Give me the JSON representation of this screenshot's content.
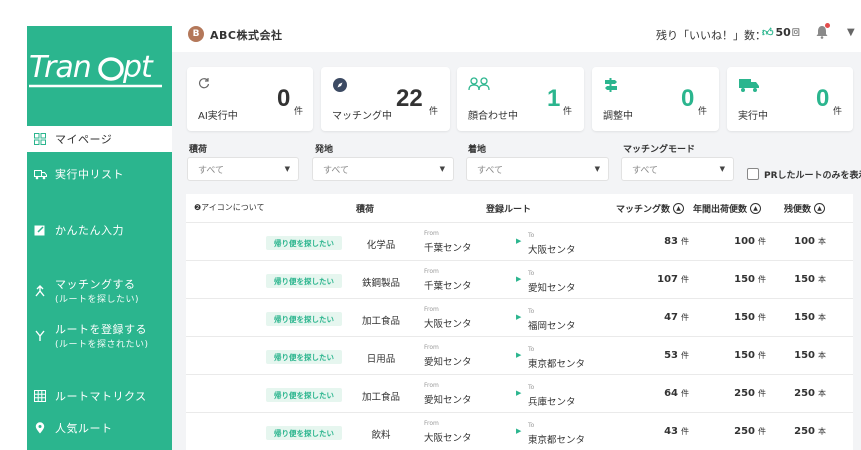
{
  "header": {
    "company_badge": "B",
    "company_name": "ABC株式会社",
    "likes_label": "残り「いいね！」数：",
    "likes_count": "50",
    "likes_unit": "回"
  },
  "sidebar": {
    "logo": "TranOpt",
    "items": [
      {
        "label": "マイページ",
        "sub": "",
        "icon": "grid-icon",
        "active": true
      },
      {
        "label": "実行中リスト",
        "sub": "",
        "icon": "truck-icon",
        "active": false
      },
      {
        "label": "かんたん入力",
        "sub": "",
        "icon": "edit-icon",
        "active": false
      },
      {
        "label": "マッチングする",
        "sub": "(ルートを探したい)",
        "icon": "match-icon",
        "active": false
      },
      {
        "label": "ルートを登録する",
        "sub": "(ルートを探されたい)",
        "icon": "route-icon",
        "active": false
      },
      {
        "label": "ルートマトリクス",
        "sub": "",
        "icon": "table-icon",
        "active": false
      },
      {
        "label": "人気ルート",
        "sub": "",
        "icon": "pin-icon",
        "active": false
      }
    ]
  },
  "cards": [
    {
      "label": "AI実行中",
      "value": "0",
      "unit": "件",
      "icon": "refresh-icon",
      "green": false
    },
    {
      "label": "マッチング中",
      "value": "22",
      "unit": "件",
      "icon": "compass-icon",
      "green": false
    },
    {
      "label": "顔合わせ中",
      "value": "1",
      "unit": "件",
      "icon": "people-icon",
      "green": true
    },
    {
      "label": "調整中",
      "value": "0",
      "unit": "件",
      "icon": "signpost-icon",
      "green": true
    },
    {
      "label": "実行中",
      "value": "0",
      "unit": "件",
      "icon": "truck-icon",
      "green": true
    }
  ],
  "filters": [
    {
      "label": "積荷",
      "value": "すべて"
    },
    {
      "label": "発地",
      "value": "すべて"
    },
    {
      "label": "着地",
      "value": "すべて"
    },
    {
      "label": "マッチングモード",
      "value": "すべて"
    }
  ],
  "pr_filter_label": "PRしたルートのみを表示",
  "table": {
    "headers": {
      "icon_about": "❷アイコンについて",
      "cargo": "積荷",
      "route": "登録ルート",
      "matching": "マッチング数",
      "annual": "年間出荷便数",
      "remaining": "残便数"
    },
    "from_label": "From",
    "to_label": "To",
    "rows": [
      {
        "tag": "帰り便を探したい",
        "cargo": "化学品",
        "from": "千葉センタ",
        "to": "大阪センタ",
        "matching": "83",
        "matching_unit": "件",
        "annual": "100",
        "annual_unit": "件",
        "remaining": "100",
        "remaining_unit": "本"
      },
      {
        "tag": "帰り便を探したい",
        "cargo": "鉄鋼製品",
        "from": "千葉センタ",
        "to": "愛知センタ",
        "matching": "107",
        "matching_unit": "件",
        "annual": "150",
        "annual_unit": "件",
        "remaining": "150",
        "remaining_unit": "本"
      },
      {
        "tag": "帰り便を探したい",
        "cargo": "加工食品",
        "from": "大阪センタ",
        "to": "福岡センタ",
        "matching": "47",
        "matching_unit": "件",
        "annual": "150",
        "annual_unit": "件",
        "remaining": "150",
        "remaining_unit": "本"
      },
      {
        "tag": "帰り便を探したい",
        "cargo": "日用品",
        "from": "愛知センタ",
        "to": "東京都センタ",
        "matching": "53",
        "matching_unit": "件",
        "annual": "150",
        "annual_unit": "件",
        "remaining": "150",
        "remaining_unit": "本"
      },
      {
        "tag": "帰り便を探したい",
        "cargo": "加工食品",
        "from": "愛知センタ",
        "to": "兵庫センタ",
        "matching": "64",
        "matching_unit": "件",
        "annual": "250",
        "annual_unit": "件",
        "remaining": "250",
        "remaining_unit": "本"
      },
      {
        "tag": "帰り便を探したい",
        "cargo": "飲料",
        "from": "大阪センタ",
        "to": "東京都センタ",
        "matching": "43",
        "matching_unit": "件",
        "annual": "250",
        "annual_unit": "件",
        "remaining": "250",
        "remaining_unit": "本"
      }
    ]
  },
  "colors": {
    "brand": "#2bb58e",
    "background": "#f3f4f6"
  }
}
